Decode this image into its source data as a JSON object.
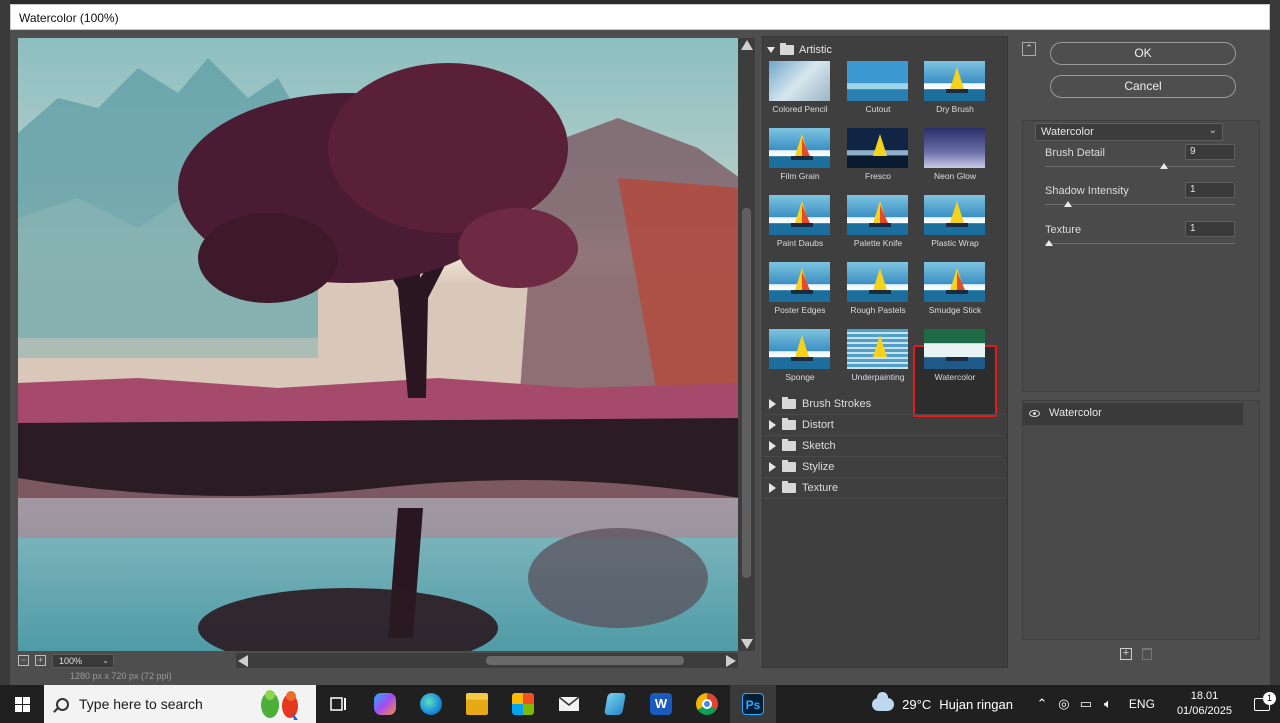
{
  "window": {
    "title": "Watercolor (100%)"
  },
  "preview": {
    "zoom": "100%",
    "status": "1280 px x 720 px (72 ppi)"
  },
  "gallery": {
    "category": "Artistic",
    "filters": [
      {
        "label": "Colored Pencil"
      },
      {
        "label": "Cutout"
      },
      {
        "label": "Dry Brush"
      },
      {
        "label": "Film Grain"
      },
      {
        "label": "Fresco"
      },
      {
        "label": "Neon Glow"
      },
      {
        "label": "Paint Daubs"
      },
      {
        "label": "Palette Knife"
      },
      {
        "label": "Plastic Wrap"
      },
      {
        "label": "Poster Edges"
      },
      {
        "label": "Rough Pastels"
      },
      {
        "label": "Smudge Stick"
      },
      {
        "label": "Sponge"
      },
      {
        "label": "Underpainting"
      },
      {
        "label": "Watercolor"
      }
    ],
    "selected": "Watercolor",
    "subcategories": [
      "Brush Strokes",
      "Distort",
      "Sketch",
      "Stylize",
      "Texture"
    ]
  },
  "actions": {
    "ok_label": "OK",
    "cancel_label": "Cancel"
  },
  "settings": {
    "filter": "Watercolor",
    "params": [
      {
        "label": "Brush Detail",
        "value": "9",
        "level": 0.62
      },
      {
        "label": "Shadow Intensity",
        "value": "1",
        "level": 0.1
      },
      {
        "label": "Texture",
        "value": "1",
        "level": 0.0
      }
    ]
  },
  "layers": {
    "items": [
      "Watercolor"
    ]
  },
  "taskbar": {
    "search_placeholder": "Type here to search",
    "apps": [
      "task-view-icon",
      "copilot-icon",
      "edge-icon",
      "file-explorer-icon",
      "store-icon",
      "mail-icon",
      "notepad-icon",
      "word-icon",
      "chrome-icon",
      "photoshop-icon"
    ],
    "photoshop_label": "Ps",
    "word_label": "W",
    "weather_temp": "29°C",
    "weather_text": "Hujan ringan",
    "language": "ENG",
    "time": "18.01",
    "date": "01/06/2025",
    "notifications": "1"
  },
  "colors": {
    "selection_outline": "#e31b1b",
    "dialog_bg": "#4e4e4e",
    "taskbar_bg": "#202020"
  }
}
